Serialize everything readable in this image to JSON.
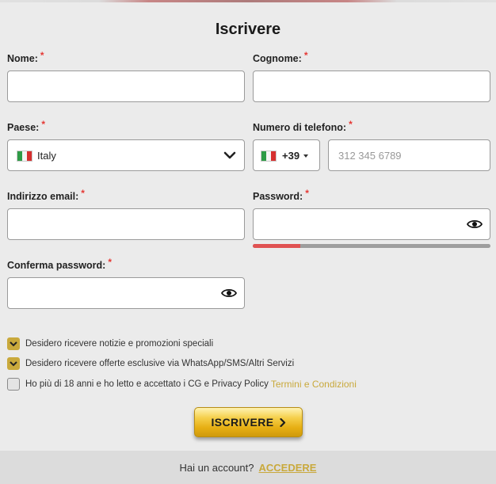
{
  "form": {
    "title": "Iscrivere",
    "required_mark": "*",
    "first_name": {
      "label": "Nome:",
      "value": ""
    },
    "last_name": {
      "label": "Cognome:",
      "value": ""
    },
    "country": {
      "label": "Paese:",
      "selected": "Italy",
      "flag_icon": "italy-flag-icon"
    },
    "phone": {
      "label": "Numero di telefono:",
      "dial_code": "+39",
      "placeholder": "312 345 6789",
      "value": ""
    },
    "email": {
      "label": "Indirizzo email:",
      "value": ""
    },
    "password": {
      "label": "Password:",
      "value": "",
      "strength": 0.2,
      "strength_color": "#e05252"
    },
    "confirm_password": {
      "label": "Conferma password:",
      "value": ""
    },
    "checkboxes": [
      {
        "label": "Desidero ricevere notizie e promozioni speciali",
        "checked": true
      },
      {
        "label": "Desidero ricevere offerte esclusive via WhatsApp/SMS/Altri Servizi",
        "checked": true
      },
      {
        "label": "Ho più di 18 anni e ho letto e accettato i CG e Privacy Policy",
        "checked": false,
        "link": "Termini e Condizioni"
      }
    ],
    "submit_label": "ISCRIVERE"
  },
  "footer": {
    "question": "Hai un account?",
    "login_label": "ACCEDERE"
  },
  "colors": {
    "accent": "#c9a93c",
    "required": "#e53935",
    "background": "#ebebeb"
  }
}
